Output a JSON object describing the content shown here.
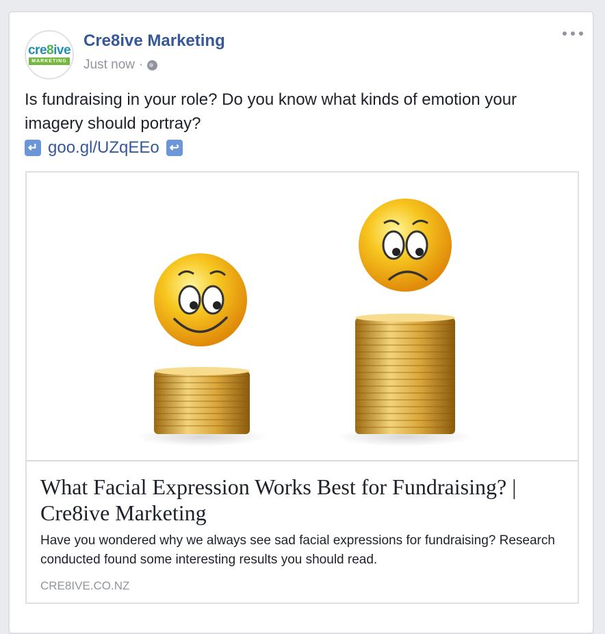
{
  "post": {
    "page_name": "Cre8ive Marketing",
    "timestamp": "Just now",
    "separator": "·",
    "privacy_icon": "globe-icon",
    "more_icon": "ellipsis-icon",
    "text": "Is fundraising in your role? Do you know what kinds of emotion your imagery should portray?",
    "link_text": "goo.gl/UZqEEo",
    "left_arrow_icon": "left-curved-arrow-icon",
    "right_arrow_icon": "return-arrow-icon"
  },
  "avatar": {
    "logo_word_pre": "cre",
    "logo_word_eight": "8",
    "logo_word_post": "ive",
    "logo_sub": "MARKETING"
  },
  "link_preview": {
    "headline": "What Facial Expression Works Best for Fundraising? | Cre8ive Marketing",
    "description": "Have you wondered why we always see sad facial expressions for fundraising? Research conducted found some interesting results you should read.",
    "domain": "CRE8IVE.CO.NZ"
  },
  "colors": {
    "link_blue": "#365899",
    "meta_gray": "#90949c",
    "coin_gold": "#d4a53b",
    "emoji_yellow": "#f7c61f"
  }
}
